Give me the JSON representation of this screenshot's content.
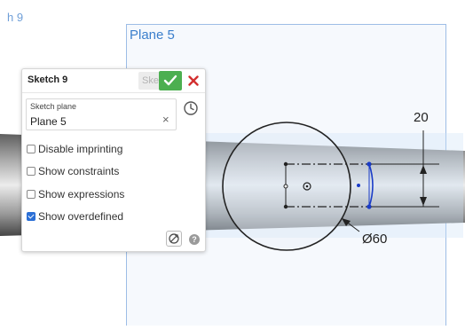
{
  "viewport": {
    "sketch_tag": "h 9",
    "plane_label": "Plane 5",
    "dimension_height": "20",
    "dimension_diameter": "Ø60"
  },
  "dialog": {
    "title": "Sketch 9",
    "ghost_tab": "Sketch 9",
    "field": {
      "label": "Sketch plane",
      "value": "Plane 5",
      "clear": "×"
    },
    "options": [
      {
        "label": "Disable imprinting",
        "checked": false
      },
      {
        "label": "Show constraints",
        "checked": false
      },
      {
        "label": "Show expressions",
        "checked": false
      },
      {
        "label": "Show overdefined",
        "checked": true
      }
    ],
    "help": "?"
  },
  "icons": {
    "ok": "check-icon",
    "cancel": "close-icon",
    "clock": "clock-icon",
    "tool": "sketch-tool-icon",
    "help": "help-icon"
  },
  "colors": {
    "ok_green": "#4caf50",
    "cancel_red": "#d32f2f",
    "plane_blue": "#3b7fcc",
    "checkbox_blue": "#2b6fd6",
    "sketch_vertex_blue": "#1a3cc8"
  }
}
